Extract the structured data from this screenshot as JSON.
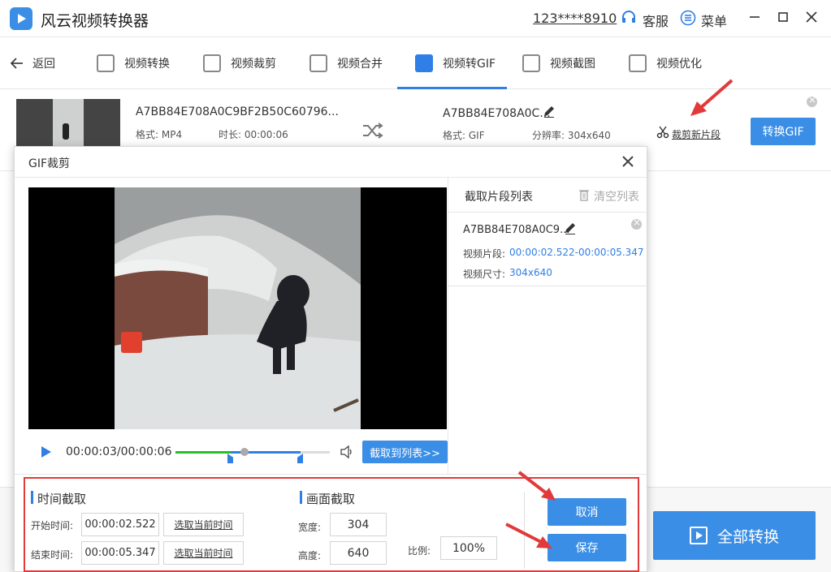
{
  "window": {
    "title": "风云视频转换器",
    "account": "123****8910",
    "service_label": "客服",
    "menu_label": "菜单"
  },
  "nav": {
    "back_label": "返回",
    "items": [
      {
        "label": "视频转换",
        "icon": "video-convert-icon"
      },
      {
        "label": "视频裁剪",
        "icon": "video-crop-icon"
      },
      {
        "label": "视频合并",
        "icon": "video-merge-icon"
      },
      {
        "label": "视频转GIF",
        "icon": "gif-icon",
        "active": true
      },
      {
        "label": "视频截图",
        "icon": "screenshot-icon"
      },
      {
        "label": "视频优化",
        "icon": "optimize-icon"
      }
    ]
  },
  "file": {
    "source_name": "A7BB84E708A0C9BF2B50C60796...",
    "source_format": "格式: MP4",
    "source_duration": "时长: 00:00:06",
    "output_name": "A7BB84E708A0C...",
    "output_format": "格式: GIF",
    "output_resolution": "分辨率: 304x640",
    "clip_link": "裁剪新片段",
    "convert_button": "转换GIF"
  },
  "dialog": {
    "title": "GIF裁剪",
    "time_display": "00:00:03/00:00:06",
    "progress_fraction": 0.5,
    "capture_button": "截取到列表>>",
    "clips_title": "截取片段列表",
    "clear_label": "清空列表",
    "clip": {
      "name": "A7BB84E708A0C9...",
      "segment_label": "视频片段:",
      "segment_value": "00:00:02.522-00:00:05.347",
      "size_label": "视频尺寸:",
      "size_value": "304x640"
    },
    "time_section": {
      "title": "时间截取",
      "start_label": "开始时间:",
      "start_value": "00:00:02.522",
      "end_label": "结束时间:",
      "end_value": "00:00:05.347",
      "pick_label": "选取当前时间"
    },
    "image_section": {
      "title": "画面截取",
      "width_label": "宽度:",
      "width_value": "304",
      "height_label": "高度:",
      "height_value": "640",
      "ratio_label": "比例:",
      "ratio_value": "100%"
    },
    "cancel_button": "取消",
    "save_button": "保存"
  },
  "footer": {
    "convert_all_button": "全部转换"
  },
  "colors": {
    "accent": "#3a8ee6",
    "highlight_red": "#e23a3a",
    "track_green": "#22c322"
  }
}
